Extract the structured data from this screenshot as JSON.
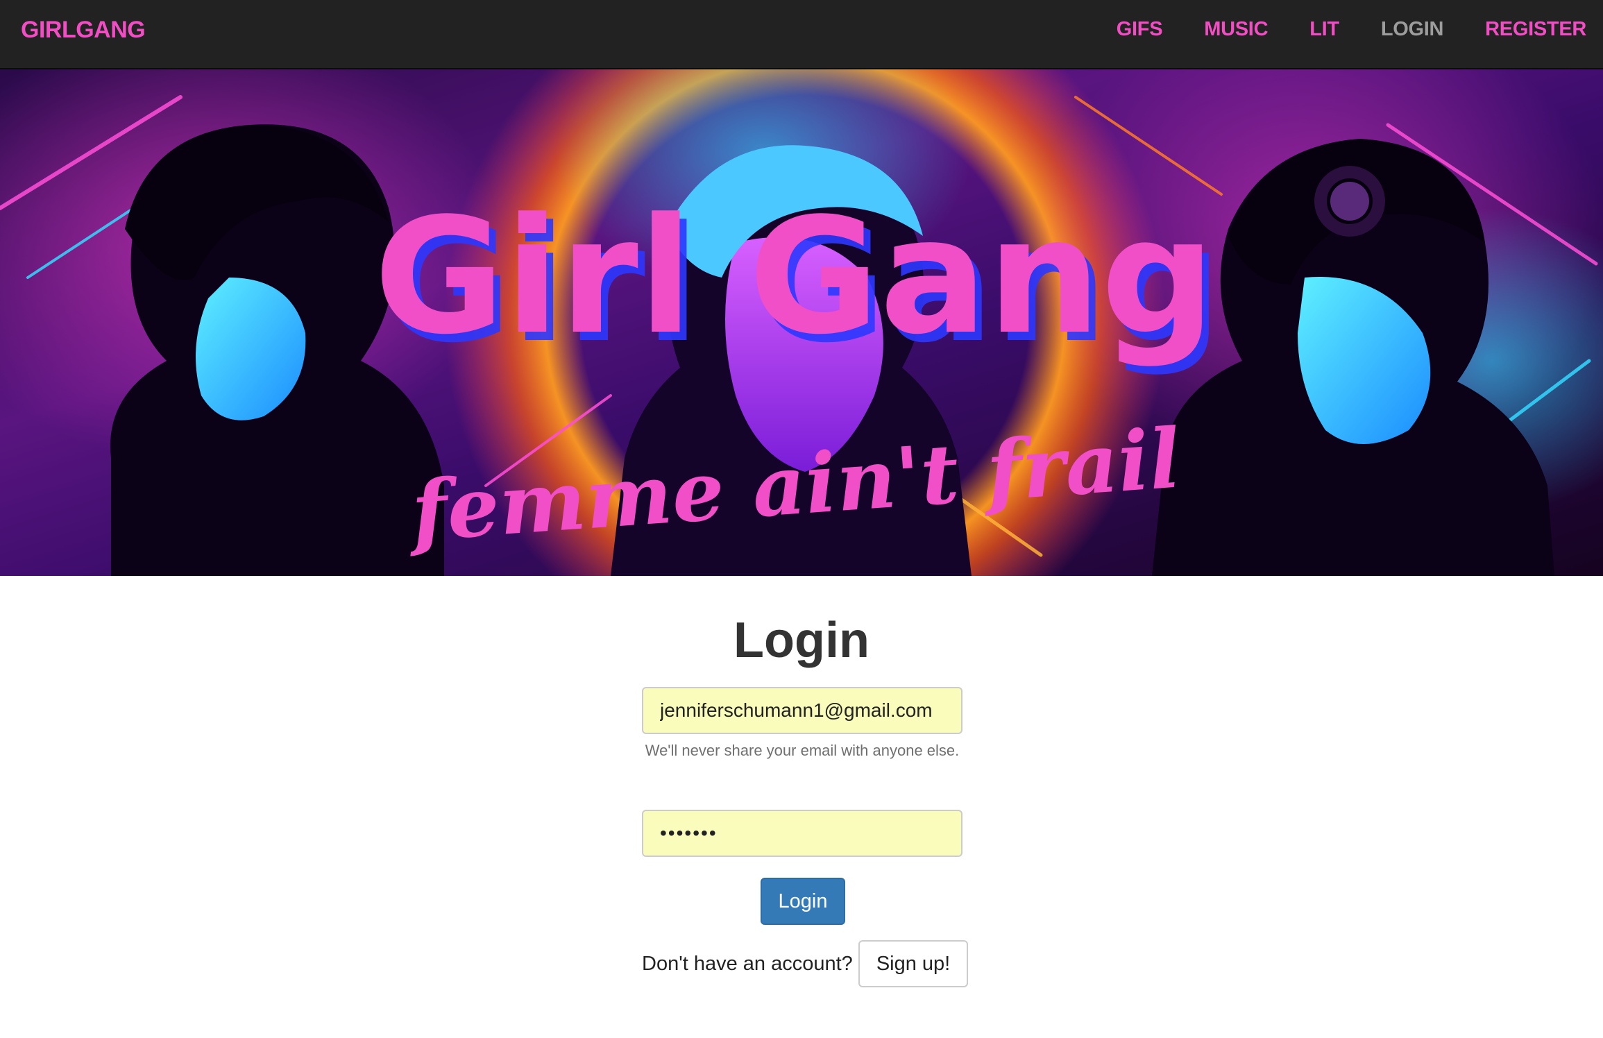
{
  "navbar": {
    "brand": "GIRLGANG",
    "links": [
      "GIFS",
      "MUSIC",
      "LIT",
      "LOGIN",
      "REGISTER"
    ],
    "active_link": "LOGIN",
    "background": "#222222",
    "accent_color": "#f24ec4"
  },
  "hero": {
    "title": "Girl Gang",
    "tagline": "femme ain't frail"
  },
  "login": {
    "heading": "Login",
    "email_value": "jenniferschumann1@gmail.com",
    "email_help": "We'll never share your email with anyone else.",
    "password_value": "•••••••",
    "submit_label": "Login",
    "signup_prompt": "Don't have an account?",
    "signup_label": "Sign up!",
    "input_fill_color": "#fafcbb",
    "primary_color": "#337ab7"
  }
}
